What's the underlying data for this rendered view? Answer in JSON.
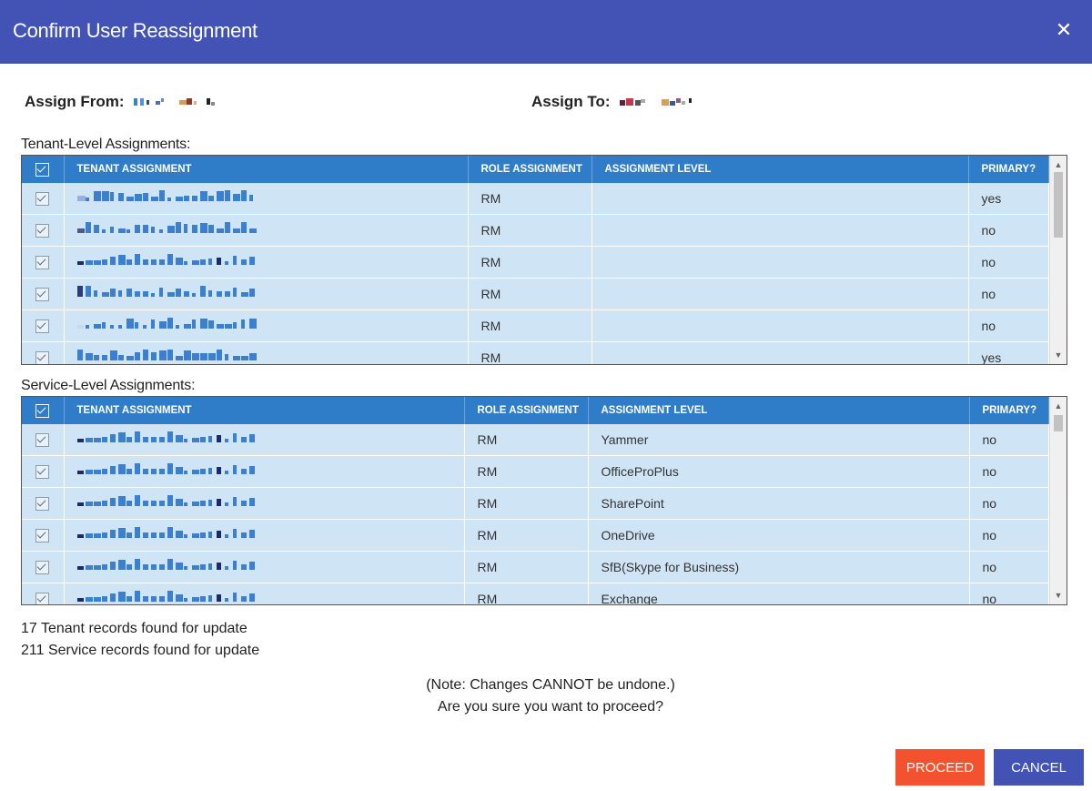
{
  "dialog": {
    "title": "Confirm User Reassignment",
    "close_icon": "close-icon"
  },
  "assign": {
    "from_label": "Assign From:",
    "to_label": "Assign To:"
  },
  "tenant_section": {
    "label": "Tenant-Level Assignments:",
    "columns": [
      "TENANT ASSIGNMENT",
      "ROLE ASSIGNMENT",
      "ASSIGNMENT LEVEL",
      "PRIMARY?"
    ],
    "rows": [
      {
        "role": "RM",
        "level": "",
        "primary": "yes"
      },
      {
        "role": "RM",
        "level": "",
        "primary": "no"
      },
      {
        "role": "RM",
        "level": "",
        "primary": "no"
      },
      {
        "role": "RM",
        "level": "",
        "primary": "no"
      },
      {
        "role": "RM",
        "level": "",
        "primary": "no"
      },
      {
        "role": "RM",
        "level": "",
        "primary": "yes"
      }
    ]
  },
  "service_section": {
    "label": "Service-Level Assignments:",
    "columns": [
      "TENANT ASSIGNMENT",
      "ROLE ASSIGNMENT",
      "ASSIGNMENT LEVEL",
      "PRIMARY?"
    ],
    "rows": [
      {
        "role": "RM",
        "level": "Yammer",
        "primary": "no"
      },
      {
        "role": "RM",
        "level": "OfficeProPlus",
        "primary": "no"
      },
      {
        "role": "RM",
        "level": "SharePoint",
        "primary": "no"
      },
      {
        "role": "RM",
        "level": "OneDrive",
        "primary": "no"
      },
      {
        "role": "RM",
        "level": "SfB(Skype for Business)",
        "primary": "no"
      },
      {
        "role": "RM",
        "level": "Exchange",
        "primary": "no"
      }
    ]
  },
  "summary": {
    "tenant_count_text": "17 Tenant records found for update",
    "service_count_text": "211 Service records found for update"
  },
  "note": {
    "line1": "(Note: Changes CANNOT be undone.)",
    "line2": "Are you sure you want to proceed?"
  },
  "buttons": {
    "proceed": "PROCEED",
    "cancel": "CANCEL"
  },
  "colors": {
    "header": "#4352b5",
    "table_header": "#2f7dc8",
    "row": "#cfe4f5",
    "proceed": "#f4522f",
    "cancel": "#4352b5"
  }
}
